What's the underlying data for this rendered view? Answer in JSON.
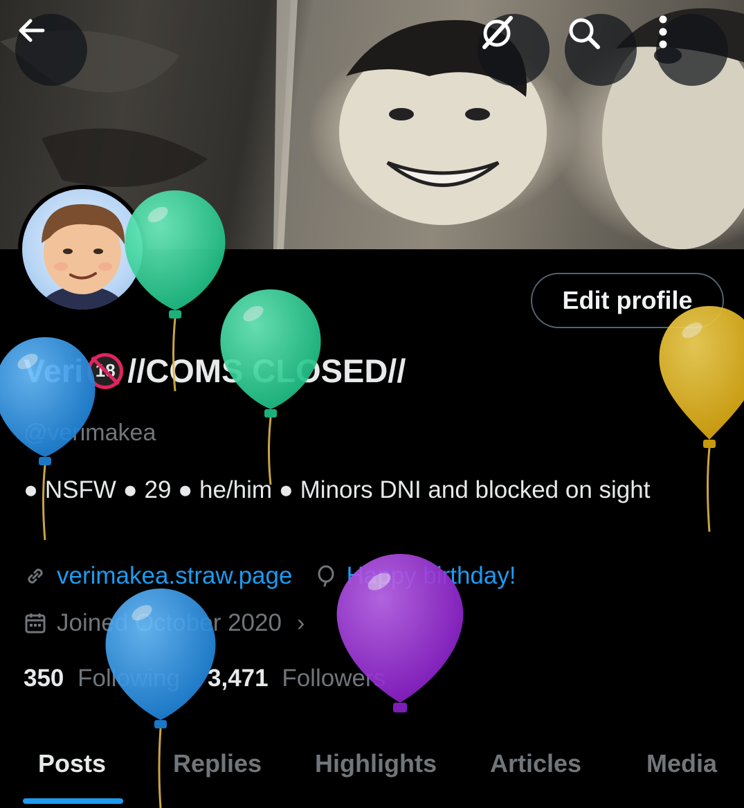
{
  "header": {
    "back_icon": "arrow-left-icon",
    "grok_icon": "grok-icon",
    "search_icon": "search-icon",
    "more_icon": "more-vertical-icon"
  },
  "profile": {
    "edit_label": "Edit profile",
    "name_prefix": "Veri",
    "name_badge": "18",
    "name_suffix": "//COMS CLOSED//",
    "handle": "@verimakea",
    "bio": "● NSFW ● 29 ● he/him ● Minors DNI and blocked on sight",
    "website": "verimakea.straw.page",
    "birthday": "Happy birthday!",
    "joined": "Joined October 2020",
    "following_count": "350",
    "following_label": "Following",
    "followers_count": "3,471",
    "followers_label": "Followers"
  },
  "tabs": [
    {
      "label": "Posts"
    },
    {
      "label": "Replies"
    },
    {
      "label": "Highlights"
    },
    {
      "label": "Articles"
    },
    {
      "label": "Media"
    }
  ],
  "colors": {
    "accent": "#1d9bf0",
    "balloon_green": "#2ed19a",
    "balloon_blue": "#2f95e6",
    "balloon_yellow": "#e0b21c",
    "balloon_purple": "#9b32d9"
  }
}
